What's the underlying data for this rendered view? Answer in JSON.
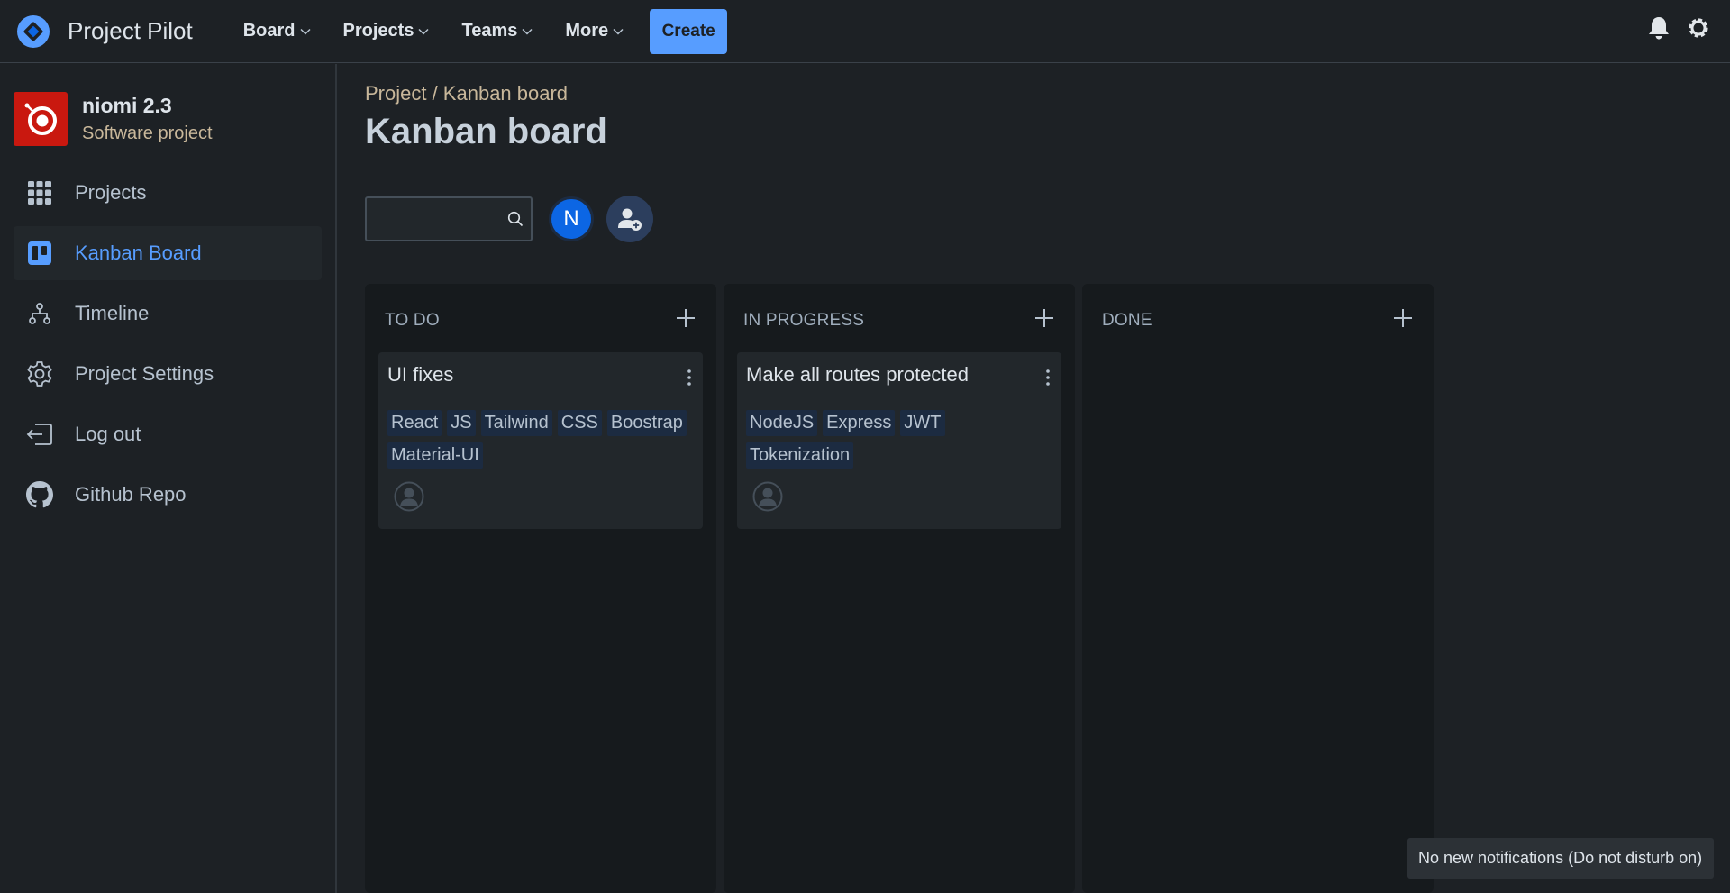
{
  "app": {
    "name": "Project Pilot",
    "logo_icon": "diamond-logo-icon",
    "accent": "#579dff"
  },
  "topnav": {
    "menus": [
      {
        "label": "Board"
      },
      {
        "label": "Projects"
      },
      {
        "label": "Teams"
      },
      {
        "label": "More"
      }
    ],
    "create_label": "Create",
    "notifications_icon": "bell-icon",
    "settings_icon": "gear-icon"
  },
  "sidebar": {
    "project_name": "niomi 2.3",
    "project_type": "Software project",
    "project_avatar_color": "#c9180f",
    "items": [
      {
        "label": "Projects",
        "icon": "grid-icon",
        "active": false
      },
      {
        "label": "Kanban Board",
        "icon": "board-icon",
        "active": true
      },
      {
        "label": "Timeline",
        "icon": "hierarchy-icon",
        "active": false
      },
      {
        "label": "Project Settings",
        "icon": "gear-icon",
        "active": false
      },
      {
        "label": "Log out",
        "icon": "logout-icon",
        "active": false
      },
      {
        "label": "Github Repo",
        "icon": "github-icon",
        "active": false
      }
    ]
  },
  "main": {
    "breadcrumb": "Project / Kanban board",
    "title": "Kanban board",
    "search": {
      "value": "",
      "placeholder": ""
    },
    "user_initial": "N",
    "add_member_icon": "add-user-icon"
  },
  "board": {
    "columns": [
      {
        "title": "TO DO",
        "cards": [
          {
            "title": "UI fixes",
            "tags": [
              "React",
              "JS",
              "Tailwind",
              "CSS",
              "Boostrap",
              "Material-UI"
            ]
          }
        ]
      },
      {
        "title": "IN PROGRESS",
        "cards": [
          {
            "title": "Make all routes protected",
            "tags": [
              "NodeJS",
              "Express",
              "JWT",
              "Tokenization"
            ]
          }
        ]
      },
      {
        "title": "DONE",
        "cards": []
      }
    ]
  },
  "toast": {
    "text": "No new notifications (Do not disturb on)"
  }
}
